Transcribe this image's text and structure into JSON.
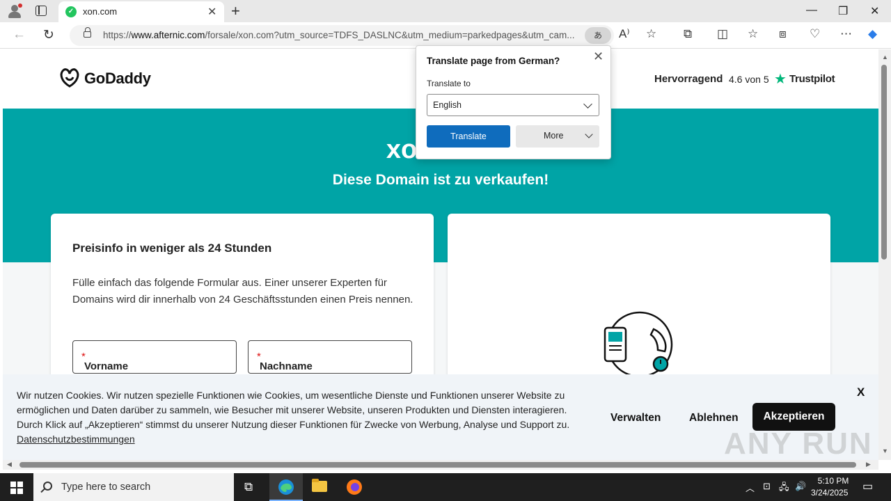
{
  "browser": {
    "tab_title": "xon.com",
    "url_prefix": "https://",
    "url_host": "www.afternic.com",
    "url_rest": "/forsale/xon.com?utm_source=TDFS_DASLNC&utm_medium=parkedpages&utm_cam...",
    "translate_icon": "あ"
  },
  "translate_popup": {
    "title": "Translate page from German?",
    "translate_to_label": "Translate to",
    "language": "English",
    "translate_button": "Translate",
    "more_button": "More"
  },
  "header": {
    "logo_text": "GoDaddy",
    "rating_word": "Hervorragend",
    "rating_score": "4.6 von 5",
    "trustpilot": "Trustpilot"
  },
  "hero": {
    "domain": "xon.com",
    "subtitle": "Diese Domain ist zu verkaufen!"
  },
  "form_card": {
    "title": "Preisinfo in weniger als 24 Stunden",
    "description": "Fülle einfach das folgende Formular aus. Einer unserer Experten für Domains wird dir innerhalb von 24 Geschäftsstunden einen Preis nennen.",
    "first_name_label": "Vorname",
    "last_name_label": "Nachname",
    "required_mark": "*"
  },
  "cookie_banner": {
    "text": "Wir nutzen Cookies. Wir nutzen spezielle Funktionen wie Cookies, um wesentliche Dienste und Funktionen unserer Website zu ermöglichen und Daten darüber zu sammeln, wie Besucher mit unserer Website, unseren Produkten und Diensten interagieren. Durch Klick auf „Akzeptieren“ stimmst du unserer Nutzung dieser Funktionen für Zwecke von Werbung, Analyse und Support zu.",
    "privacy_link": "Datenschutzbestimmungen",
    "close_label": "X",
    "manage_button": "Verwalten",
    "reject_button": "Ablehnen",
    "accept_button": "Akzeptieren"
  },
  "watermark": "ANY RUN",
  "taskbar": {
    "search_placeholder": "Type here to search",
    "time": "5:10 PM",
    "date": "3/24/2025"
  },
  "colors": {
    "hero_teal": "#00a4a6",
    "accept_black": "#111111",
    "translate_blue": "#0f6cbd",
    "trustpilot_green": "#00b67a"
  }
}
